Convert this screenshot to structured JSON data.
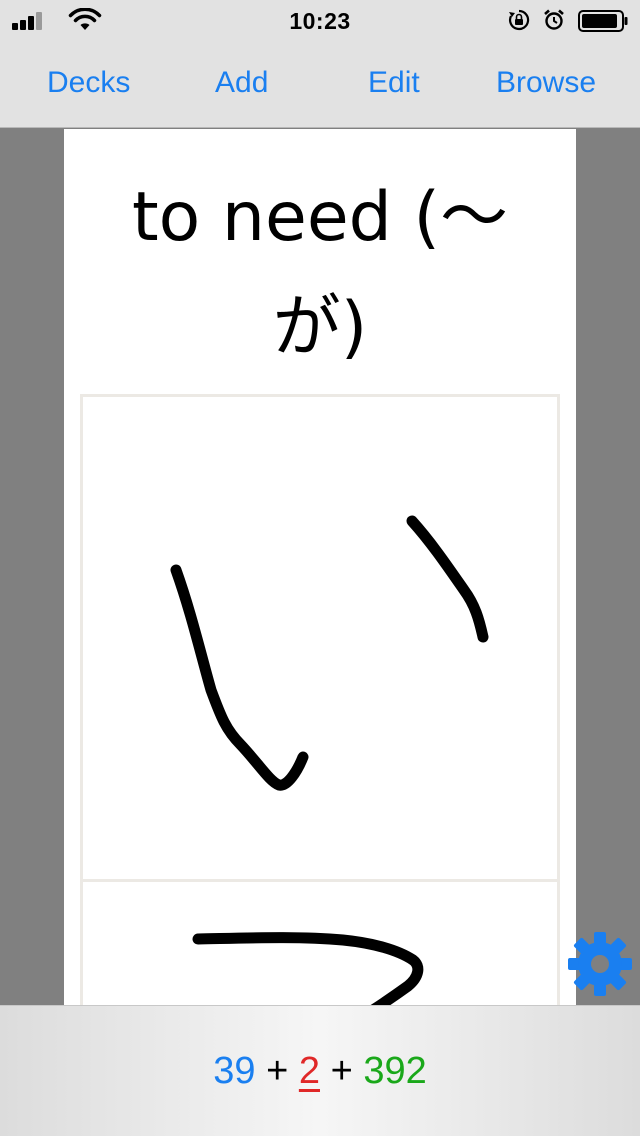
{
  "status_bar": {
    "time": "10:23",
    "signal_icon": "cellular-signal-icon",
    "wifi_icon": "wifi-icon",
    "orientation_lock_icon": "orientation-lock-icon",
    "alarm_icon": "alarm-icon",
    "battery_icon": "battery-icon"
  },
  "nav": {
    "decks": "Decks",
    "add": "Add",
    "edit": "Edit",
    "browse": "Browse",
    "color": "#1a7ff0"
  },
  "card": {
    "question": "to need (〜が)",
    "question_line1": "to need (〜",
    "question_line2": "が)",
    "drawing_icon": "handwriting-canvas"
  },
  "settings": {
    "icon": "gear-icon",
    "color": "#1a7ff0"
  },
  "counts": {
    "new": "39",
    "sep1": "+",
    "learning": "2",
    "sep2": "+",
    "review": "392",
    "new_color": "#1a7ff0",
    "learning_color": "#e02828",
    "review_color": "#1aa81a"
  }
}
